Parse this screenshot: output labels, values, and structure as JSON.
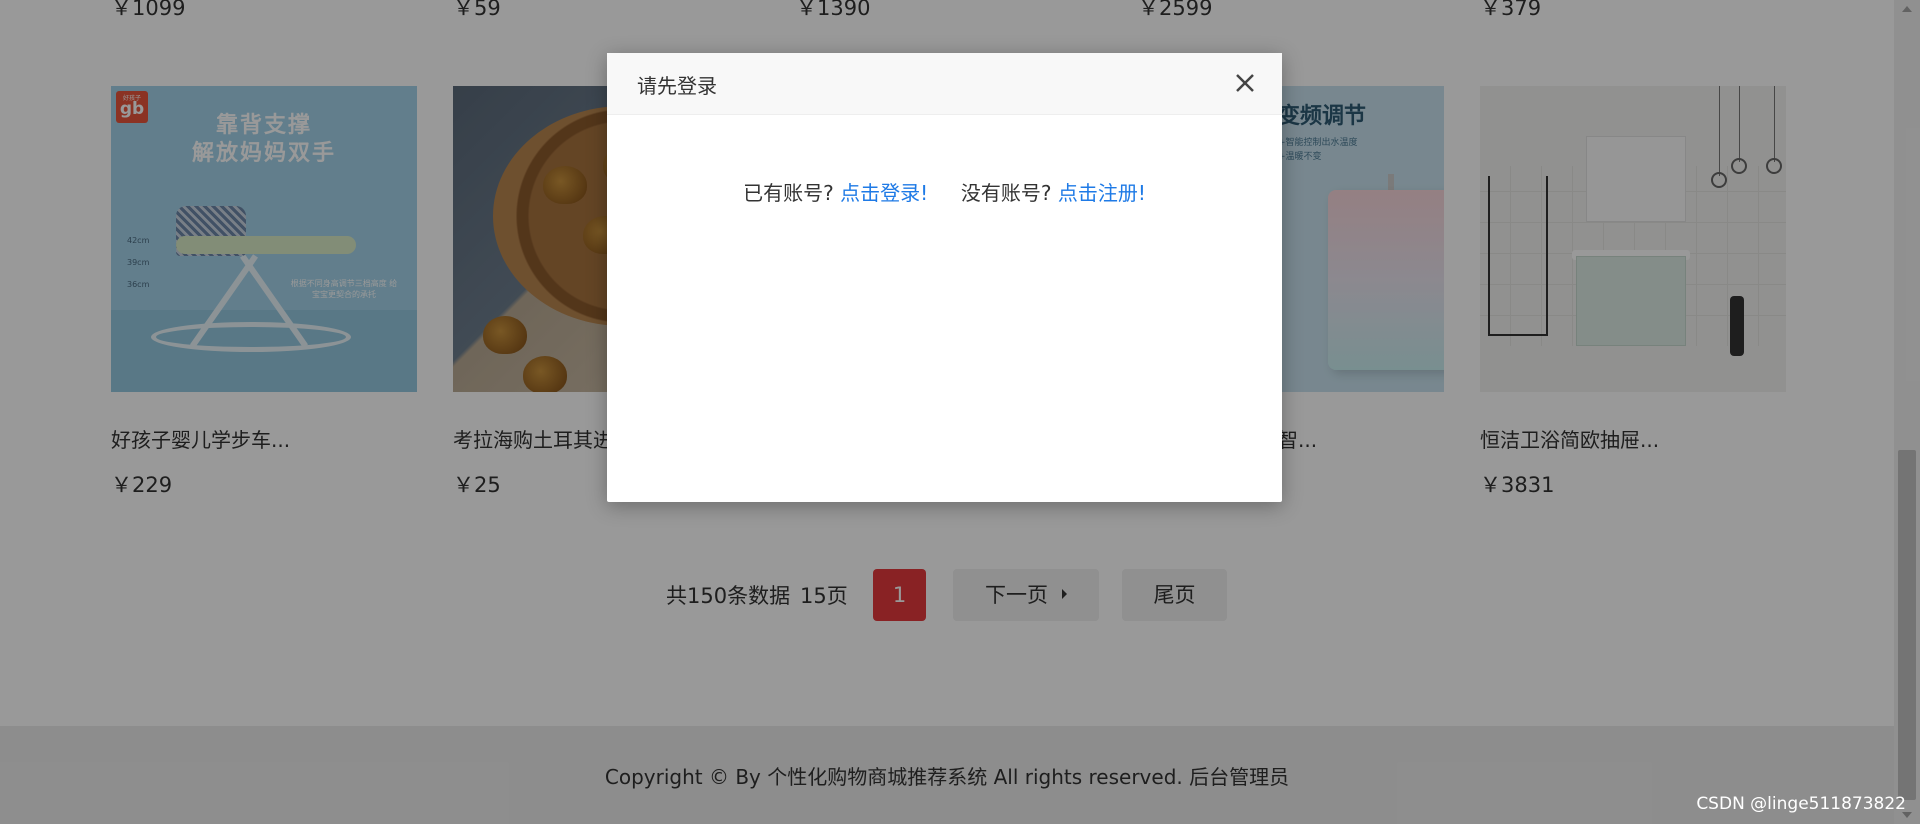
{
  "top_prices": [
    "￥1099",
    "￥59",
    "￥1390",
    "￥2599",
    "￥379"
  ],
  "products": [
    {
      "name": "好孩子婴儿学步车...",
      "price": "￥229",
      "image_text": {
        "brand_small": "好孩子",
        "brand": "gb",
        "headline_1": "靠背支撑",
        "headline_2": "解放妈妈双手",
        "dims": [
          "42cm",
          "39cm",
          "36cm"
        ],
        "note": "根据不同身高调节三档高度 给宝宝更契合的承托"
      }
    },
    {
      "name": "考拉海购土耳其进",
      "price": "￥25"
    },
    {
      "name": "",
      "price": ""
    },
    {
      "name": "智...",
      "price": "",
      "image_text": {
        "title": "变频调节",
        "sub_1": "+智能控制出水温度",
        "sub_2": "+温暖不变"
      }
    },
    {
      "name": "恒洁卫浴简欧抽屉...",
      "price": "￥3831"
    }
  ],
  "pagination": {
    "total": "共150条数据",
    "pages": "15页",
    "current": "1",
    "next": "下一页",
    "last": "尾页"
  },
  "footer": {
    "copyright": "Copyright © By 个性化购物商城推荐系统 All rights reserved. 后台管理员"
  },
  "dialog": {
    "title": "请先登录",
    "close_icon": "close-icon",
    "has_account": "已有账号?",
    "login_link": "点击登录!",
    "no_account": "没有账号?",
    "register_link": "点击注册!"
  },
  "watermark": "CSDN @linge511873822",
  "colors": {
    "accent": "#e4393c",
    "link": "#1e7ae6",
    "overlay": "rgba(0,0,0,0.4)"
  }
}
